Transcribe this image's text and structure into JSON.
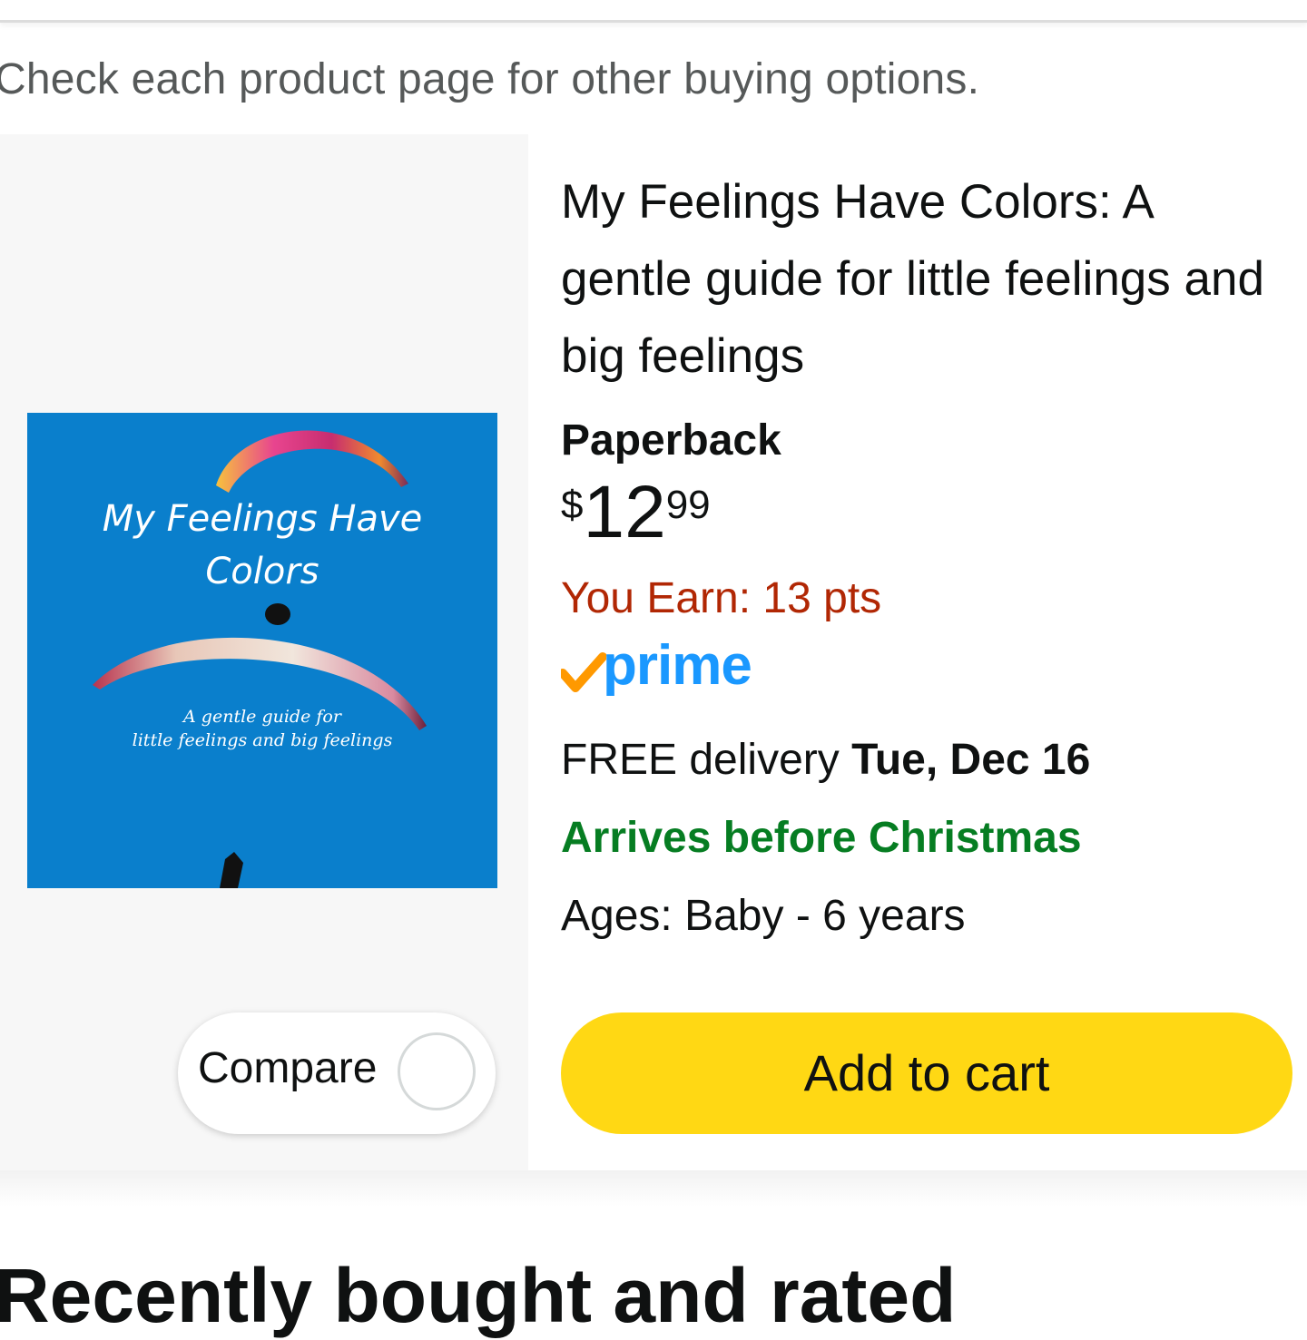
{
  "notice": "Check each product page for other buying options.",
  "product": {
    "cover": {
      "title_line1": "My Feelings Have",
      "title_line2": "Colors",
      "subtitle_line1": "A gentle guide for",
      "subtitle_line2": "little feelings and big feelings"
    },
    "compare_label": "Compare",
    "title": "My Feelings Have Colors: A gentle guide for little feelings and big feelings",
    "format": "Paperback",
    "price": {
      "symbol": "$",
      "whole": "12",
      "fraction": "99"
    },
    "earn": "You Earn: 13 pts",
    "prime_label": "prime",
    "delivery_prefix": "FREE delivery ",
    "delivery_date": "Tue, Dec 16",
    "arrives": "Arrives before Christmas",
    "ages": "Ages: Baby - 6 years",
    "add_to_cart": "Add to cart"
  },
  "next_section_title": "Recently bought and rated",
  "colors": {
    "cart_button": "#ffd814",
    "earn_text": "#b12704",
    "arrives_text": "#067d22",
    "prime_blue": "#1a98ff",
    "prime_check": "#ff9900",
    "cover_bg": "#0a7fcc"
  }
}
